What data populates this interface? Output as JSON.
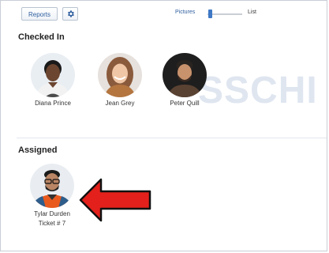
{
  "toolbar": {
    "reports_label": "Reports",
    "settings_icon": "gear-icon",
    "view_toggle": {
      "left_label": "Pictures",
      "right_label": "List",
      "selected": "Pictures"
    }
  },
  "checked_in": {
    "title": "Checked In",
    "people": [
      {
        "name": "Diana Prince"
      },
      {
        "name": "Jean Grey"
      },
      {
        "name": "Peter Quill"
      }
    ]
  },
  "watermark_text": "SSCHI",
  "assigned": {
    "title": "Assigned",
    "people": [
      {
        "name": "Tylar Durden",
        "ticket": "Ticket # 7"
      }
    ]
  },
  "annotation": {
    "arrow_color": "#e3201b"
  },
  "colors": {
    "accent": "#2f5f9f",
    "slider_thumb": "#3f78c5"
  }
}
